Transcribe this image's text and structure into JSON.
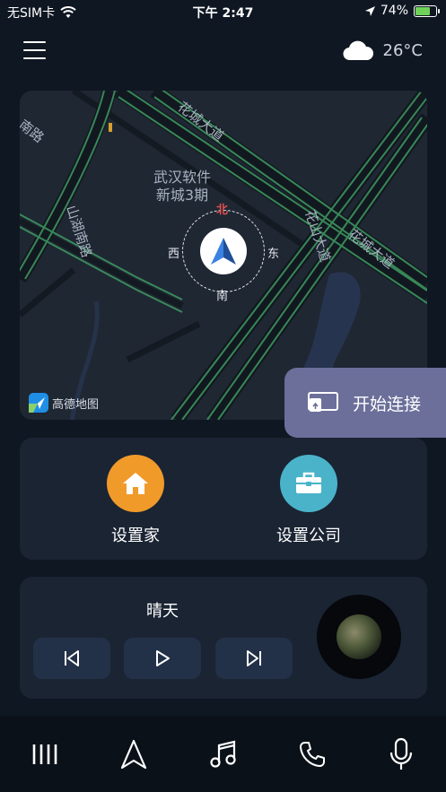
{
  "status_bar": {
    "carrier": "无SIM卡",
    "time": "下午 2:47",
    "battery_percent": "74%",
    "battery_level": 0.74
  },
  "header": {
    "menu_icon": "menu-icon",
    "weather_icon": "cloud-icon",
    "temperature": "26°C"
  },
  "map": {
    "roads": [
      "花城大道",
      "花山大道",
      "花城大道",
      "南路",
      "山湖南路"
    ],
    "area_label_line1": "武汉软件",
    "area_label_line2": "新城3期",
    "compass": {
      "north": "北",
      "south": "南",
      "west": "西",
      "east": "东"
    },
    "provider": "高德地图"
  },
  "connect": {
    "label": "开始连接",
    "icon": "screen-cast-icon"
  },
  "places": [
    {
      "label": "设置家",
      "icon": "home-icon",
      "color": "#f09a2a"
    },
    {
      "label": "设置公司",
      "icon": "briefcase-icon",
      "color": "#4ab3c9"
    }
  ],
  "music": {
    "title": "晴天",
    "controls": [
      "previous-icon",
      "play-icon",
      "next-icon"
    ]
  },
  "bottom_nav": [
    "apps-icon",
    "navigation-icon",
    "music-icon",
    "phone-icon",
    "microphone-icon"
  ],
  "colors": {
    "background": "#0f1722",
    "card": "#1a2433",
    "connect": "#6b6f9a",
    "road_glow": "#3f9b62"
  }
}
